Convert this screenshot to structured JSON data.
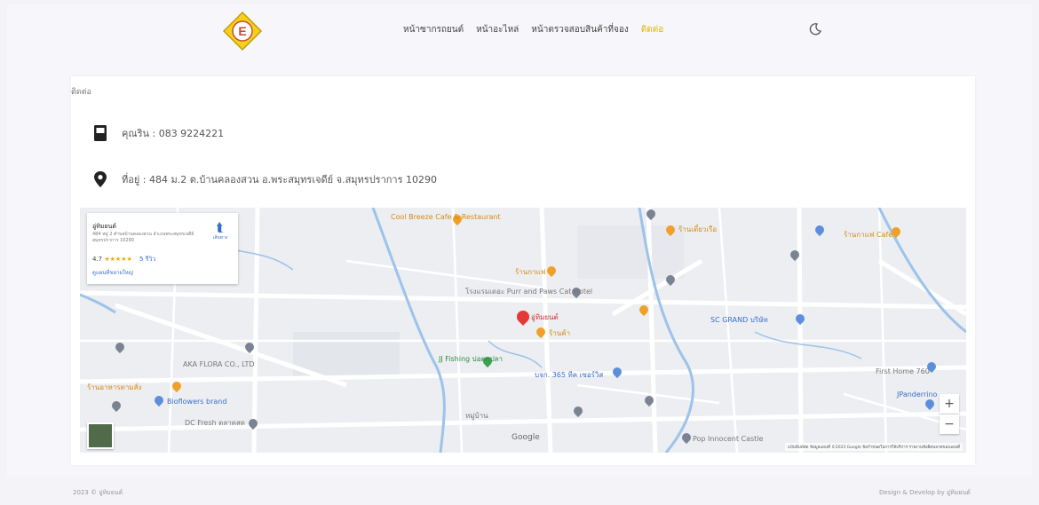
{
  "nav": {
    "menu": [
      "หน้าซากรถยนต์",
      "หน้าอะไหล่",
      "หน้าตรวจสอบสินค้าที่จอง",
      "ติดต่อ"
    ],
    "logo_icon": "shop-logo",
    "theme_icon": "moon-icon"
  },
  "card": {
    "title": "ติดต่อ",
    "phone": "คุณริน : 083 9224221",
    "phone_icon": "phone-icon",
    "address": "ที่อยู่ : 484 ม.2 ต.บ้านคลองสวน อ.พระสมุทรเจดีย์ จ.สมุทรปราการ 10290",
    "address_icon": "location-pin-icon"
  },
  "map": {
    "info": {
      "title": "อู่ทิมยนต์",
      "address": "484 หมู่ 2 ตำบลบ้านคลองสวน อำเภอพระสมุทรเจดีย์ สมุทรปราการ 10290",
      "rating": "4.7",
      "stars": "★★★★★",
      "reviews": "5 รีวิว",
      "link": "ดูแผนที่ขยายใหญ่",
      "directions": "เส้นทาง"
    },
    "labels": [
      {
        "text": "Cool Breeze Cafe & Restaurant",
        "cls": "lbl-orange"
      },
      {
        "text": "ร้านเตี๋ยวเรือ",
        "cls": "lbl-orange"
      },
      {
        "text": "ร้านกาแฟ",
        "cls": "lbl-orange"
      },
      {
        "text": "โรงแรมเดอะ Purr and Paws Cat Hotel",
        "cls": "lbl-gray"
      },
      {
        "text": "อู่ทิมยนต์",
        "cls": "lbl-red"
      },
      {
        "text": "ร้านค้า",
        "cls": "lbl-orange"
      },
      {
        "text": "JJ Fishing บ่อตกปลา",
        "cls": "lbl-green"
      },
      {
        "text": "บจก. 365 ทีค เซอร์วิส",
        "cls": "lbl-blue"
      },
      {
        "text": "AKA FLORA CO., LTD",
        "cls": "lbl-gray"
      },
      {
        "text": "ร้านอาหารตามสั่ง",
        "cls": "lbl-orange"
      },
      {
        "text": "Bioflowers brand",
        "cls": "lbl-blue"
      },
      {
        "text": "DC Fresh ตลาดสด",
        "cls": "lbl-gray"
      },
      {
        "text": "SC GRAND บริษัท",
        "cls": "lbl-blue"
      },
      {
        "text": "First Home 760",
        "cls": "lbl-gray"
      },
      {
        "text": "JPanderrino",
        "cls": "lbl-blue"
      },
      {
        "text": "Pop Innocent Castle",
        "cls": "lbl-gray"
      },
      {
        "text": "ร้านกาแฟ Cafe",
        "cls": "lbl-orange"
      },
      {
        "text": "หมู่บ้าน",
        "cls": "lbl-gray"
      }
    ],
    "google": "Google",
    "attribution": "แป้นพิมพ์ลัด  ข้อมูลแผนที่ ©2023 Google  ข้อกำหนดในการให้บริการ  รายงานข้อผิดพลาดของแผนที่",
    "zoom_in": "+",
    "zoom_out": "−"
  },
  "footer": {
    "left": "2023 © อู่ทิมยนต์",
    "right": "Design & Develop by อู่ทิมยนต์"
  }
}
